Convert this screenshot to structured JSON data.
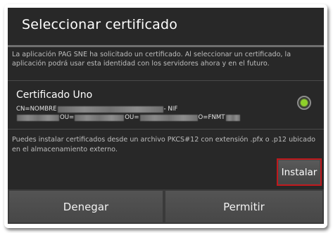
{
  "dialog": {
    "title": "Seleccionar certificado",
    "info": "La aplicación PAG SNE ha solicitado un certificado. Al seleccionar un certificado, la aplicación podrá usar esta identidad con los servidores ahora y en el futuro."
  },
  "certificate": {
    "name": "Certificado Uno",
    "line1_prefix": "CN=NOMBRE",
    "line1_suffix": "- NIF",
    "line2_ou1": "OU=",
    "line2_ou2": "OU=",
    "line2_o": "O=FNMT",
    "selected": true
  },
  "install": {
    "info": "Puedes instalar certificados desde un archivo PKCS#12 con extensión .pfx o .p12 ubicado en el almacenamiento externo.",
    "button_label": "Instalar"
  },
  "actions": {
    "deny_label": "Denegar",
    "allow_label": "Permitir"
  },
  "colors": {
    "radio_selected": "#8fd12a",
    "highlight_border": "#c0181c",
    "dialog_background": "#282828"
  }
}
